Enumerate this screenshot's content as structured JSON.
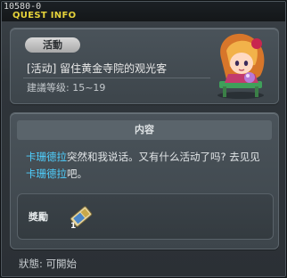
{
  "window": {
    "id": "10580-0",
    "title": "QUEST INFO"
  },
  "quest": {
    "category_badge": "活動",
    "name": "[活动] 留住黄金寺院的观光客",
    "level": "建議等级: 15~19"
  },
  "content": {
    "header": "内容",
    "description_parts": [
      {
        "text": "卡珊德拉",
        "highlight": true
      },
      {
        "text": "突然和我说话。又有什么活动了吗? 去见见",
        "highlight": false
      },
      {
        "text": "卡珊德拉",
        "highlight": true
      },
      {
        "text": "吧。",
        "highlight": false
      }
    ]
  },
  "reward": {
    "label": "獎勵",
    "item_icon": "ticket-icon",
    "item_count": "1"
  },
  "status": {
    "text": "狀態: 可開始"
  },
  "colors": {
    "title_yellow": "#e6d33a",
    "npc_highlight": "#4fd0ff"
  }
}
